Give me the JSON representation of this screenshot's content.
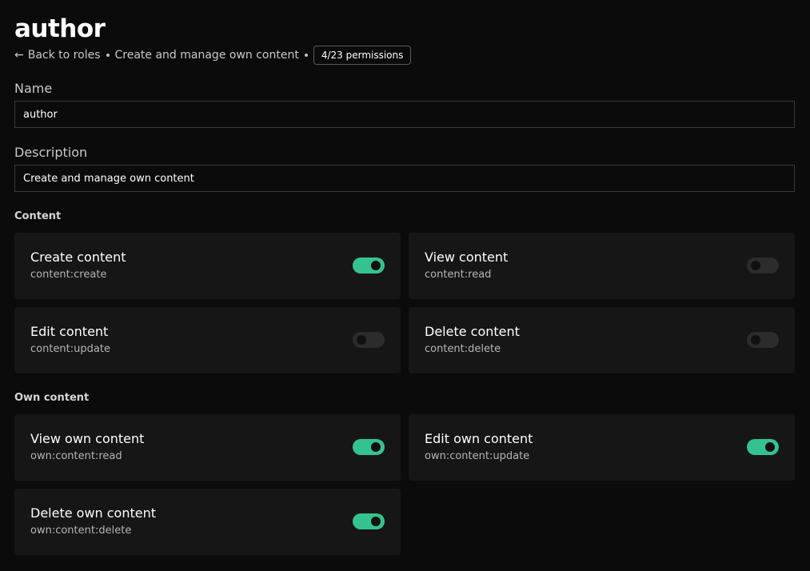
{
  "page": {
    "title": "author",
    "back_label": "Back to roles",
    "description": "Create and manage own content",
    "permission_badge": "4/23 permissions"
  },
  "form": {
    "name_label": "Name",
    "name_value": "author",
    "description_label": "Description",
    "description_value": "Create and manage own content"
  },
  "sections": [
    {
      "title": "Content",
      "permissions": [
        {
          "label": "Create content",
          "key": "content:create",
          "enabled": true
        },
        {
          "label": "View content",
          "key": "content:read",
          "enabled": false
        },
        {
          "label": "Edit content",
          "key": "content:update",
          "enabled": false
        },
        {
          "label": "Delete content",
          "key": "content:delete",
          "enabled": false
        }
      ]
    },
    {
      "title": "Own content",
      "permissions": [
        {
          "label": "View own content",
          "key": "own:content:read",
          "enabled": true
        },
        {
          "label": "Edit own content",
          "key": "own:content:update",
          "enabled": true
        },
        {
          "label": "Delete own content",
          "key": "own:content:delete",
          "enabled": true
        }
      ]
    }
  ],
  "colors": {
    "toggle_on": "#34c390",
    "toggle_off": "#2c2c2c",
    "background": "#0b0b0b",
    "card": "#161616"
  },
  "icons": {
    "back": "arrow-left-icon"
  }
}
